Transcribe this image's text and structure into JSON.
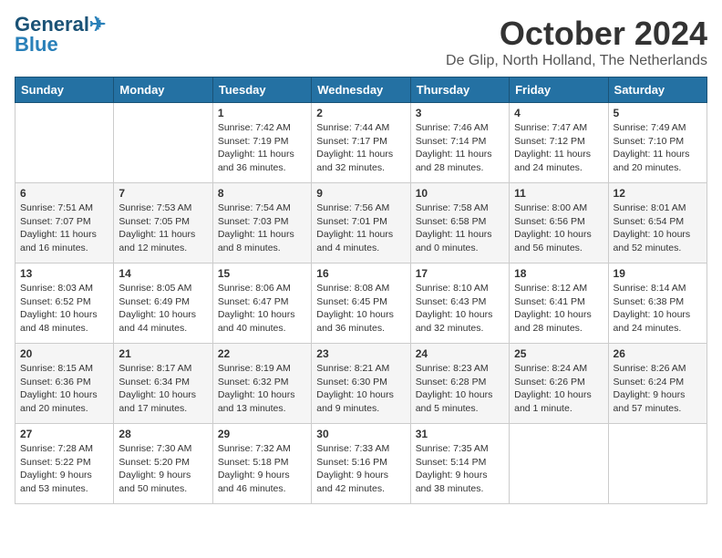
{
  "header": {
    "logo_line1": "General",
    "logo_line2": "Blue",
    "month": "October 2024",
    "location": "De Glip, North Holland, The Netherlands"
  },
  "days_of_week": [
    "Sunday",
    "Monday",
    "Tuesday",
    "Wednesday",
    "Thursday",
    "Friday",
    "Saturday"
  ],
  "weeks": [
    {
      "days": [
        {
          "num": "",
          "content": ""
        },
        {
          "num": "",
          "content": ""
        },
        {
          "num": "1",
          "content": "Sunrise: 7:42 AM\nSunset: 7:19 PM\nDaylight: 11 hours\nand 36 minutes."
        },
        {
          "num": "2",
          "content": "Sunrise: 7:44 AM\nSunset: 7:17 PM\nDaylight: 11 hours\nand 32 minutes."
        },
        {
          "num": "3",
          "content": "Sunrise: 7:46 AM\nSunset: 7:14 PM\nDaylight: 11 hours\nand 28 minutes."
        },
        {
          "num": "4",
          "content": "Sunrise: 7:47 AM\nSunset: 7:12 PM\nDaylight: 11 hours\nand 24 minutes."
        },
        {
          "num": "5",
          "content": "Sunrise: 7:49 AM\nSunset: 7:10 PM\nDaylight: 11 hours\nand 20 minutes."
        }
      ]
    },
    {
      "days": [
        {
          "num": "6",
          "content": "Sunrise: 7:51 AM\nSunset: 7:07 PM\nDaylight: 11 hours\nand 16 minutes."
        },
        {
          "num": "7",
          "content": "Sunrise: 7:53 AM\nSunset: 7:05 PM\nDaylight: 11 hours\nand 12 minutes."
        },
        {
          "num": "8",
          "content": "Sunrise: 7:54 AM\nSunset: 7:03 PM\nDaylight: 11 hours\nand 8 minutes."
        },
        {
          "num": "9",
          "content": "Sunrise: 7:56 AM\nSunset: 7:01 PM\nDaylight: 11 hours\nand 4 minutes."
        },
        {
          "num": "10",
          "content": "Sunrise: 7:58 AM\nSunset: 6:58 PM\nDaylight: 11 hours\nand 0 minutes."
        },
        {
          "num": "11",
          "content": "Sunrise: 8:00 AM\nSunset: 6:56 PM\nDaylight: 10 hours\nand 56 minutes."
        },
        {
          "num": "12",
          "content": "Sunrise: 8:01 AM\nSunset: 6:54 PM\nDaylight: 10 hours\nand 52 minutes."
        }
      ]
    },
    {
      "days": [
        {
          "num": "13",
          "content": "Sunrise: 8:03 AM\nSunset: 6:52 PM\nDaylight: 10 hours\nand 48 minutes."
        },
        {
          "num": "14",
          "content": "Sunrise: 8:05 AM\nSunset: 6:49 PM\nDaylight: 10 hours\nand 44 minutes."
        },
        {
          "num": "15",
          "content": "Sunrise: 8:06 AM\nSunset: 6:47 PM\nDaylight: 10 hours\nand 40 minutes."
        },
        {
          "num": "16",
          "content": "Sunrise: 8:08 AM\nSunset: 6:45 PM\nDaylight: 10 hours\nand 36 minutes."
        },
        {
          "num": "17",
          "content": "Sunrise: 8:10 AM\nSunset: 6:43 PM\nDaylight: 10 hours\nand 32 minutes."
        },
        {
          "num": "18",
          "content": "Sunrise: 8:12 AM\nSunset: 6:41 PM\nDaylight: 10 hours\nand 28 minutes."
        },
        {
          "num": "19",
          "content": "Sunrise: 8:14 AM\nSunset: 6:38 PM\nDaylight: 10 hours\nand 24 minutes."
        }
      ]
    },
    {
      "days": [
        {
          "num": "20",
          "content": "Sunrise: 8:15 AM\nSunset: 6:36 PM\nDaylight: 10 hours\nand 20 minutes."
        },
        {
          "num": "21",
          "content": "Sunrise: 8:17 AM\nSunset: 6:34 PM\nDaylight: 10 hours\nand 17 minutes."
        },
        {
          "num": "22",
          "content": "Sunrise: 8:19 AM\nSunset: 6:32 PM\nDaylight: 10 hours\nand 13 minutes."
        },
        {
          "num": "23",
          "content": "Sunrise: 8:21 AM\nSunset: 6:30 PM\nDaylight: 10 hours\nand 9 minutes."
        },
        {
          "num": "24",
          "content": "Sunrise: 8:23 AM\nSunset: 6:28 PM\nDaylight: 10 hours\nand 5 minutes."
        },
        {
          "num": "25",
          "content": "Sunrise: 8:24 AM\nSunset: 6:26 PM\nDaylight: 10 hours\nand 1 minute."
        },
        {
          "num": "26",
          "content": "Sunrise: 8:26 AM\nSunset: 6:24 PM\nDaylight: 9 hours\nand 57 minutes."
        }
      ]
    },
    {
      "days": [
        {
          "num": "27",
          "content": "Sunrise: 7:28 AM\nSunset: 5:22 PM\nDaylight: 9 hours\nand 53 minutes."
        },
        {
          "num": "28",
          "content": "Sunrise: 7:30 AM\nSunset: 5:20 PM\nDaylight: 9 hours\nand 50 minutes."
        },
        {
          "num": "29",
          "content": "Sunrise: 7:32 AM\nSunset: 5:18 PM\nDaylight: 9 hours\nand 46 minutes."
        },
        {
          "num": "30",
          "content": "Sunrise: 7:33 AM\nSunset: 5:16 PM\nDaylight: 9 hours\nand 42 minutes."
        },
        {
          "num": "31",
          "content": "Sunrise: 7:35 AM\nSunset: 5:14 PM\nDaylight: 9 hours\nand 38 minutes."
        },
        {
          "num": "",
          "content": ""
        },
        {
          "num": "",
          "content": ""
        }
      ]
    }
  ]
}
